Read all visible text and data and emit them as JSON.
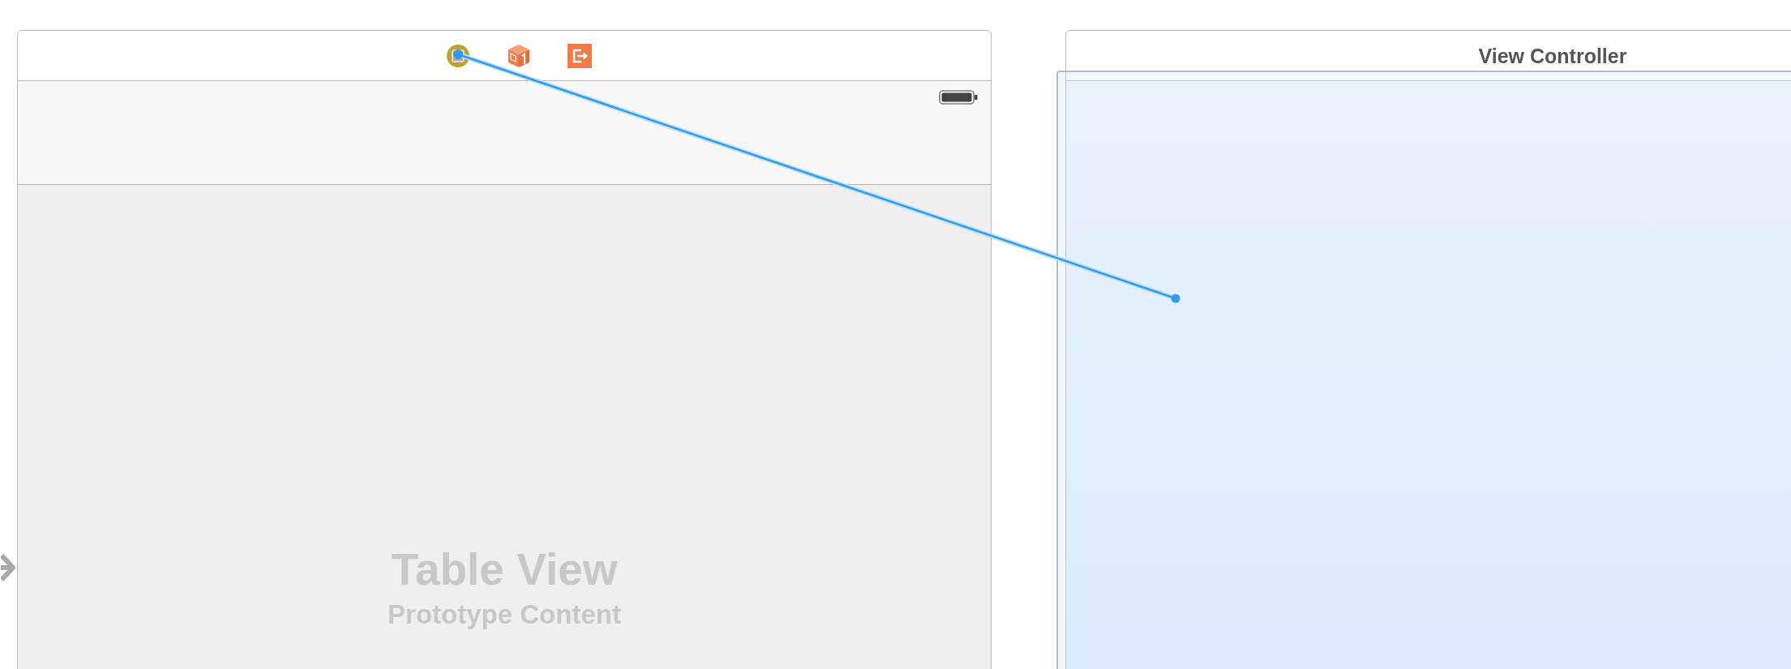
{
  "scenes": [
    {
      "kind": "table_view_controller",
      "selected": false,
      "initial": true,
      "dock": [
        {
          "kind": "view_controller"
        },
        {
          "kind": "first_responder"
        },
        {
          "kind": "exit"
        }
      ],
      "table_view": {
        "title": "Table View",
        "subtitle": "Prototype Content"
      }
    },
    {
      "kind": "view_controller",
      "selected": true,
      "title": "View Controller"
    }
  ],
  "connection_drag": true
}
